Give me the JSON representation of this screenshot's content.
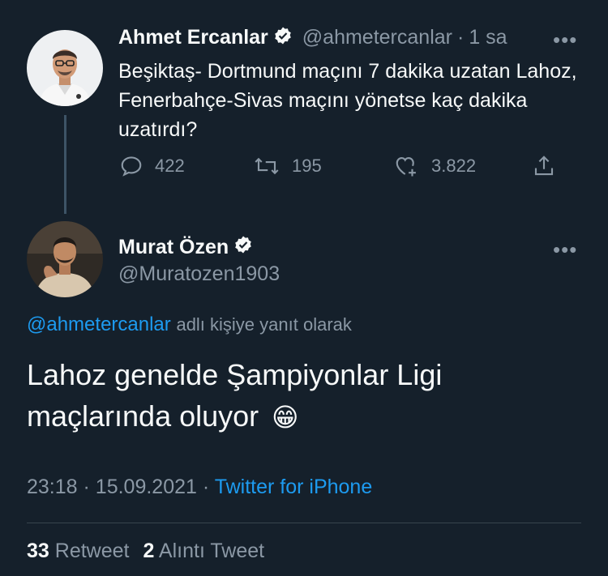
{
  "parent_tweet": {
    "author_name": "Ahmet Ercanlar",
    "handle": "@ahmetercanlar",
    "separator": "·",
    "time_ago": "1 sa",
    "text": "Beşiktaş- Dortmund maçını 7 dakika uzatan Lahoz, Fenerbahçe-Sivas maçını yönetse kaç dakika uzatırdı?",
    "replies": "422",
    "retweets": "195",
    "likes": "3.822",
    "more": "•••"
  },
  "reply_tweet": {
    "author_name": "Murat Özen",
    "handle": "@Muratozen1903",
    "reply_to_handle": "@ahmetercanlar",
    "reply_to_suffix": "adlı kişiye yanıt olarak",
    "text": "Lahoz genelde Şampiyonlar Ligi maçlarında oluyor",
    "emoji": "😁",
    "time": "23:18",
    "separator": "·",
    "date": "15.09.2021",
    "source": "Twitter for iPhone",
    "more": "•••"
  },
  "stats": {
    "retweet_count": "33",
    "retweet_label": "Retweet",
    "quote_count": "2",
    "quote_label": "Alıntı Tweet"
  },
  "colors": {
    "background": "#15202b",
    "text": "#f7f9f9",
    "muted": "#8b98a5",
    "link": "#1d9bf0",
    "divider": "#38444d"
  },
  "icons": [
    "verified-badge-icon",
    "reply-icon",
    "retweet-icon",
    "like-icon",
    "share-icon",
    "more-icon"
  ]
}
